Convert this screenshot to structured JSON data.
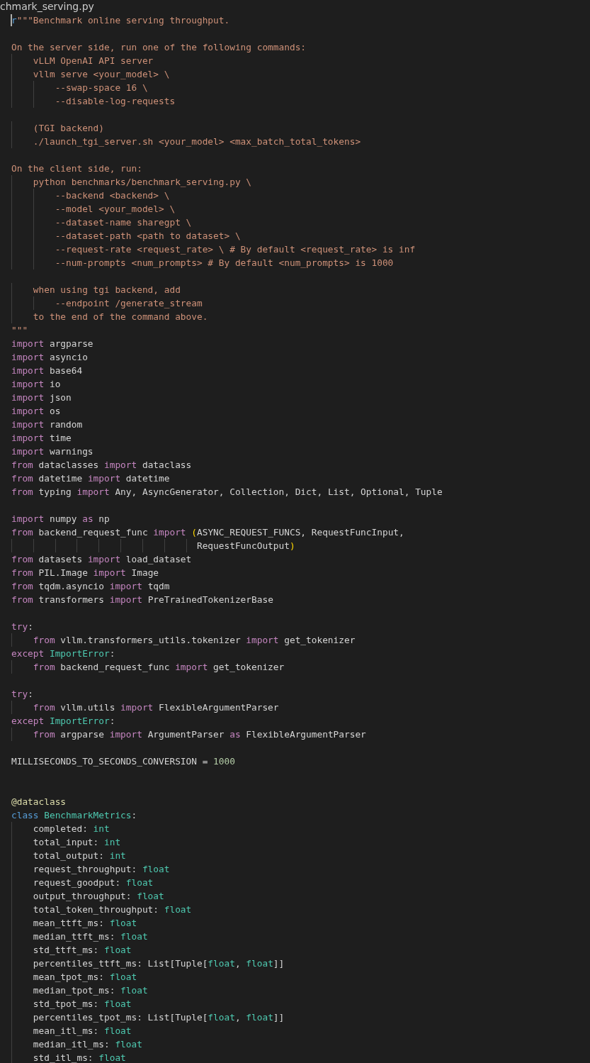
{
  "editor_tab": {
    "title": "chmark_serving.py"
  },
  "lines": [
    {
      "kind": "code",
      "tokens": [
        {
          "kind": "keyword",
          "text": "r"
        },
        {
          "kind": "string",
          "text": "\"\"\"Benchmark online serving throughput."
        }
      ]
    },
    {
      "kind": "blank"
    },
    {
      "kind": "code",
      "tokens": [
        {
          "kind": "string",
          "text": "On the server side, run one of the following commands:"
        }
      ]
    },
    {
      "kind": "code",
      "tokens": [
        {
          "kind": "string",
          "text": "    vLLM OpenAI API server"
        }
      ]
    },
    {
      "kind": "code",
      "tokens": [
        {
          "kind": "string",
          "text": "    vllm serve <your_model> \\"
        }
      ]
    },
    {
      "kind": "code",
      "tokens": [
        {
          "kind": "string",
          "text": "        --swap-space 16 \\"
        }
      ]
    },
    {
      "kind": "code",
      "tokens": [
        {
          "kind": "string",
          "text": "        --disable-log-requests"
        }
      ]
    },
    {
      "kind": "blank"
    },
    {
      "kind": "code",
      "tokens": [
        {
          "kind": "string",
          "text": "    (TGI backend)"
        }
      ]
    },
    {
      "kind": "code",
      "tokens": [
        {
          "kind": "string",
          "text": "    ./launch_tgi_server.sh <your_model> <max_batch_total_tokens>"
        }
      ]
    },
    {
      "kind": "blank"
    },
    {
      "kind": "code",
      "tokens": [
        {
          "kind": "string",
          "text": "On the client side, run:"
        }
      ]
    },
    {
      "kind": "code",
      "tokens": [
        {
          "kind": "string",
          "text": "    python benchmarks/benchmark_serving.py \\"
        }
      ]
    },
    {
      "kind": "code",
      "tokens": [
        {
          "kind": "string",
          "text": "        --backend <backend> \\"
        }
      ]
    },
    {
      "kind": "code",
      "tokens": [
        {
          "kind": "string",
          "text": "        --model <your_model> \\"
        }
      ]
    },
    {
      "kind": "code",
      "tokens": [
        {
          "kind": "string",
          "text": "        --dataset-name sharegpt \\"
        }
      ]
    },
    {
      "kind": "code",
      "tokens": [
        {
          "kind": "string",
          "text": "        --dataset-path <path to dataset> \\"
        }
      ]
    },
    {
      "kind": "code",
      "tokens": [
        {
          "kind": "string",
          "text": "        --request-rate <request_rate> \\ # By default <request_rate> is inf"
        }
      ]
    },
    {
      "kind": "code",
      "tokens": [
        {
          "kind": "string",
          "text": "        --num-prompts <num_prompts> # By default <num_prompts> is 1000"
        }
      ]
    },
    {
      "kind": "blank"
    },
    {
      "kind": "code",
      "tokens": [
        {
          "kind": "string",
          "text": "    when using tgi backend, add"
        }
      ]
    },
    {
      "kind": "code",
      "tokens": [
        {
          "kind": "string",
          "text": "        --endpoint /generate_stream"
        }
      ]
    },
    {
      "kind": "code",
      "tokens": [
        {
          "kind": "string",
          "text": "    to the end of the command above."
        }
      ]
    },
    {
      "kind": "code",
      "tokens": [
        {
          "kind": "string",
          "text": "\"\"\""
        }
      ]
    },
    {
      "kind": "code",
      "tokens": [
        {
          "kind": "control",
          "text": "import"
        },
        {
          "kind": "plain",
          "text": " argparse"
        }
      ]
    },
    {
      "kind": "code",
      "tokens": [
        {
          "kind": "control",
          "text": "import"
        },
        {
          "kind": "plain",
          "text": " asyncio"
        }
      ]
    },
    {
      "kind": "code",
      "tokens": [
        {
          "kind": "control",
          "text": "import"
        },
        {
          "kind": "plain",
          "text": " base64"
        }
      ]
    },
    {
      "kind": "code",
      "tokens": [
        {
          "kind": "control",
          "text": "import"
        },
        {
          "kind": "plain",
          "text": " io"
        }
      ]
    },
    {
      "kind": "code",
      "tokens": [
        {
          "kind": "control",
          "text": "import"
        },
        {
          "kind": "plain",
          "text": " json"
        }
      ]
    },
    {
      "kind": "code",
      "tokens": [
        {
          "kind": "control",
          "text": "import"
        },
        {
          "kind": "plain",
          "text": " os"
        }
      ]
    },
    {
      "kind": "code",
      "tokens": [
        {
          "kind": "control",
          "text": "import"
        },
        {
          "kind": "plain",
          "text": " random"
        }
      ]
    },
    {
      "kind": "code",
      "tokens": [
        {
          "kind": "control",
          "text": "import"
        },
        {
          "kind": "plain",
          "text": " time"
        }
      ]
    },
    {
      "kind": "code",
      "tokens": [
        {
          "kind": "control",
          "text": "import"
        },
        {
          "kind": "plain",
          "text": " warnings"
        }
      ]
    },
    {
      "kind": "code",
      "tokens": [
        {
          "kind": "control",
          "text": "from"
        },
        {
          "kind": "plain",
          "text": " dataclasses "
        },
        {
          "kind": "control",
          "text": "import"
        },
        {
          "kind": "plain",
          "text": " dataclass"
        }
      ]
    },
    {
      "kind": "code",
      "tokens": [
        {
          "kind": "control",
          "text": "from"
        },
        {
          "kind": "plain",
          "text": " datetime "
        },
        {
          "kind": "control",
          "text": "import"
        },
        {
          "kind": "plain",
          "text": " datetime"
        }
      ]
    },
    {
      "kind": "code",
      "tokens": [
        {
          "kind": "control",
          "text": "from"
        },
        {
          "kind": "plain",
          "text": " typing "
        },
        {
          "kind": "control",
          "text": "import"
        },
        {
          "kind": "plain",
          "text": " Any, AsyncGenerator, Collection, Dict, List, Optional, Tuple"
        }
      ]
    },
    {
      "kind": "blank"
    },
    {
      "kind": "code",
      "tokens": [
        {
          "kind": "control",
          "text": "import"
        },
        {
          "kind": "plain",
          "text": " numpy "
        },
        {
          "kind": "control",
          "text": "as"
        },
        {
          "kind": "plain",
          "text": " np"
        }
      ]
    },
    {
      "kind": "code",
      "tokens": [
        {
          "kind": "control",
          "text": "from"
        },
        {
          "kind": "plain",
          "text": " backend_request_func "
        },
        {
          "kind": "control",
          "text": "import"
        },
        {
          "kind": "bracket",
          "text": " ("
        },
        {
          "kind": "plain",
          "text": "ASYNC_REQUEST_FUNCS, RequestFuncInput,"
        }
      ]
    },
    {
      "kind": "code",
      "tokens": [
        {
          "kind": "plain",
          "text": "                                  RequestFuncOutput"
        },
        {
          "kind": "bracket",
          "text": ")"
        }
      ]
    },
    {
      "kind": "code",
      "tokens": [
        {
          "kind": "control",
          "text": "from"
        },
        {
          "kind": "plain",
          "text": " datasets "
        },
        {
          "kind": "control",
          "text": "import"
        },
        {
          "kind": "plain",
          "text": " load_dataset"
        }
      ]
    },
    {
      "kind": "code",
      "tokens": [
        {
          "kind": "control",
          "text": "from"
        },
        {
          "kind": "plain",
          "text": " PIL.Image "
        },
        {
          "kind": "control",
          "text": "import"
        },
        {
          "kind": "plain",
          "text": " Image"
        }
      ]
    },
    {
      "kind": "code",
      "tokens": [
        {
          "kind": "control",
          "text": "from"
        },
        {
          "kind": "plain",
          "text": " tqdm.asyncio "
        },
        {
          "kind": "control",
          "text": "import"
        },
        {
          "kind": "plain",
          "text": " tqdm"
        }
      ]
    },
    {
      "kind": "code",
      "tokens": [
        {
          "kind": "control",
          "text": "from"
        },
        {
          "kind": "plain",
          "text": " transformers "
        },
        {
          "kind": "control",
          "text": "import"
        },
        {
          "kind": "plain",
          "text": " PreTrainedTokenizerBase"
        }
      ]
    },
    {
      "kind": "blank"
    },
    {
      "kind": "code",
      "tokens": [
        {
          "kind": "control",
          "text": "try"
        },
        {
          "kind": "plain",
          "text": ":"
        }
      ]
    },
    {
      "kind": "code",
      "tokens": [
        {
          "kind": "control",
          "text": "    from"
        },
        {
          "kind": "plain",
          "text": " vllm.transformers_utils.tokenizer "
        },
        {
          "kind": "control",
          "text": "import"
        },
        {
          "kind": "plain",
          "text": " get_tokenizer"
        }
      ]
    },
    {
      "kind": "code",
      "tokens": [
        {
          "kind": "control",
          "text": "except"
        },
        {
          "kind": "type",
          "text": " ImportError"
        },
        {
          "kind": "plain",
          "text": ":"
        }
      ]
    },
    {
      "kind": "code",
      "tokens": [
        {
          "kind": "control",
          "text": "    from"
        },
        {
          "kind": "plain",
          "text": " backend_request_func "
        },
        {
          "kind": "control",
          "text": "import"
        },
        {
          "kind": "plain",
          "text": " get_tokenizer"
        }
      ]
    },
    {
      "kind": "blank"
    },
    {
      "kind": "code",
      "tokens": [
        {
          "kind": "control",
          "text": "try"
        },
        {
          "kind": "plain",
          "text": ":"
        }
      ]
    },
    {
      "kind": "code",
      "tokens": [
        {
          "kind": "control",
          "text": "    from"
        },
        {
          "kind": "plain",
          "text": " vllm.utils "
        },
        {
          "kind": "control",
          "text": "import"
        },
        {
          "kind": "plain",
          "text": " FlexibleArgumentParser"
        }
      ]
    },
    {
      "kind": "code",
      "tokens": [
        {
          "kind": "control",
          "text": "except"
        },
        {
          "kind": "type",
          "text": " ImportError"
        },
        {
          "kind": "plain",
          "text": ":"
        }
      ]
    },
    {
      "kind": "code",
      "tokens": [
        {
          "kind": "control",
          "text": "    from"
        },
        {
          "kind": "plain",
          "text": " argparse "
        },
        {
          "kind": "control",
          "text": "import"
        },
        {
          "kind": "plain",
          "text": " ArgumentParser "
        },
        {
          "kind": "control",
          "text": "as"
        },
        {
          "kind": "plain",
          "text": " FlexibleArgumentParser"
        }
      ]
    },
    {
      "kind": "blank"
    },
    {
      "kind": "code",
      "tokens": [
        {
          "kind": "plain",
          "text": "MILLISECONDS_TO_SECONDS_CONVERSION = "
        },
        {
          "kind": "number",
          "text": "1000"
        }
      ]
    },
    {
      "kind": "blank"
    },
    {
      "kind": "blank"
    },
    {
      "kind": "code",
      "tokens": [
        {
          "kind": "decorator",
          "text": "@dataclass"
        }
      ]
    },
    {
      "kind": "code",
      "tokens": [
        {
          "kind": "keyword",
          "text": "class"
        },
        {
          "kind": "type",
          "text": " BenchmarkMetrics"
        },
        {
          "kind": "plain",
          "text": ":"
        }
      ]
    },
    {
      "kind": "code",
      "tokens": [
        {
          "kind": "plain",
          "text": "    completed: "
        },
        {
          "kind": "type",
          "text": "int"
        }
      ]
    },
    {
      "kind": "code",
      "tokens": [
        {
          "kind": "plain",
          "text": "    total_input: "
        },
        {
          "kind": "type",
          "text": "int"
        }
      ]
    },
    {
      "kind": "code",
      "tokens": [
        {
          "kind": "plain",
          "text": "    total_output: "
        },
        {
          "kind": "type",
          "text": "int"
        }
      ]
    },
    {
      "kind": "code",
      "tokens": [
        {
          "kind": "plain",
          "text": "    request_throughput: "
        },
        {
          "kind": "type",
          "text": "float"
        }
      ]
    },
    {
      "kind": "code",
      "tokens": [
        {
          "kind": "plain",
          "text": "    request_goodput: "
        },
        {
          "kind": "type",
          "text": "float"
        }
      ]
    },
    {
      "kind": "code",
      "tokens": [
        {
          "kind": "plain",
          "text": "    output_throughput: "
        },
        {
          "kind": "type",
          "text": "float"
        }
      ]
    },
    {
      "kind": "code",
      "tokens": [
        {
          "kind": "plain",
          "text": "    total_token_throughput: "
        },
        {
          "kind": "type",
          "text": "float"
        }
      ]
    },
    {
      "kind": "code",
      "tokens": [
        {
          "kind": "plain",
          "text": "    mean_ttft_ms: "
        },
        {
          "kind": "type",
          "text": "float"
        }
      ]
    },
    {
      "kind": "code",
      "tokens": [
        {
          "kind": "plain",
          "text": "    median_ttft_ms: "
        },
        {
          "kind": "type",
          "text": "float"
        }
      ]
    },
    {
      "kind": "code",
      "tokens": [
        {
          "kind": "plain",
          "text": "    std_ttft_ms: "
        },
        {
          "kind": "type",
          "text": "float"
        }
      ]
    },
    {
      "kind": "code",
      "tokens": [
        {
          "kind": "plain",
          "text": "    percentiles_ttft_ms: List[Tuple["
        },
        {
          "kind": "type",
          "text": "float"
        },
        {
          "kind": "plain",
          "text": ", "
        },
        {
          "kind": "type",
          "text": "float"
        },
        {
          "kind": "plain",
          "text": "]]"
        }
      ]
    },
    {
      "kind": "code",
      "tokens": [
        {
          "kind": "plain",
          "text": "    mean_tpot_ms: "
        },
        {
          "kind": "type",
          "text": "float"
        }
      ]
    },
    {
      "kind": "code",
      "tokens": [
        {
          "kind": "plain",
          "text": "    median_tpot_ms: "
        },
        {
          "kind": "type",
          "text": "float"
        }
      ]
    },
    {
      "kind": "code",
      "tokens": [
        {
          "kind": "plain",
          "text": "    std_tpot_ms: "
        },
        {
          "kind": "type",
          "text": "float"
        }
      ]
    },
    {
      "kind": "code",
      "tokens": [
        {
          "kind": "plain",
          "text": "    percentiles_tpot_ms: List[Tuple["
        },
        {
          "kind": "type",
          "text": "float"
        },
        {
          "kind": "plain",
          "text": ", "
        },
        {
          "kind": "type",
          "text": "float"
        },
        {
          "kind": "plain",
          "text": "]]"
        }
      ]
    },
    {
      "kind": "code",
      "tokens": [
        {
          "kind": "plain",
          "text": "    mean_itl_ms: "
        },
        {
          "kind": "type",
          "text": "float"
        }
      ]
    },
    {
      "kind": "code",
      "tokens": [
        {
          "kind": "plain",
          "text": "    median_itl_ms: "
        },
        {
          "kind": "type",
          "text": "float"
        }
      ]
    },
    {
      "kind": "code",
      "tokens": [
        {
          "kind": "plain",
          "text": "    std_itl_ms: "
        },
        {
          "kind": "type",
          "text": "float"
        }
      ]
    }
  ]
}
